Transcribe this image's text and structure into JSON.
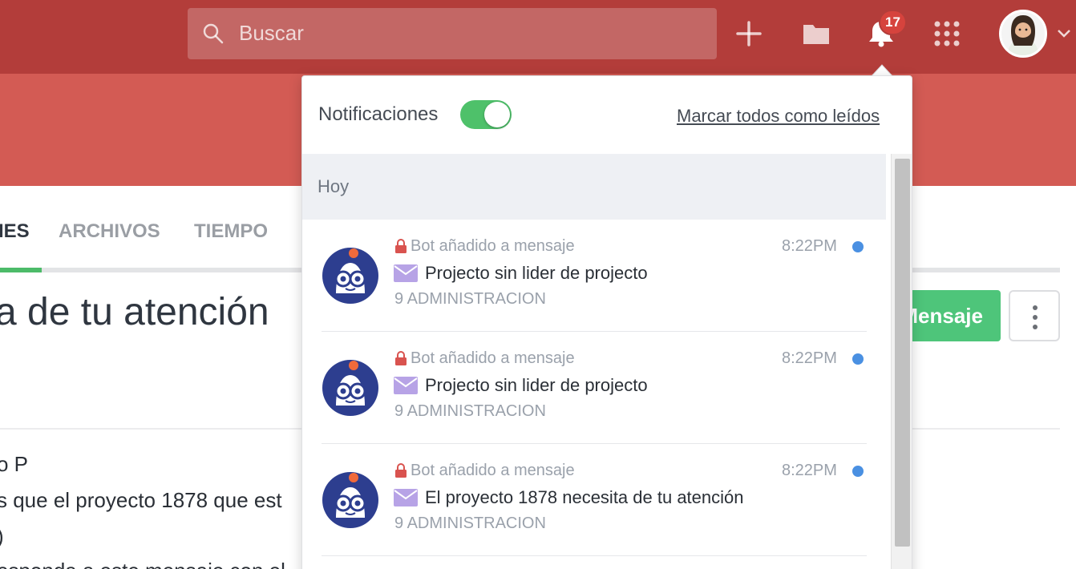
{
  "header": {
    "search_placeholder": "Buscar",
    "notification_count": "17",
    "icons": [
      "search-icon",
      "plus-icon",
      "folder-icon",
      "bell-icon",
      "apps-grid-icon",
      "chevron-down-icon"
    ],
    "bar_color": "#b33d3a",
    "banner_color": "#d35b54"
  },
  "tabs": [
    {
      "label": "IES",
      "active": true
    },
    {
      "label": "ARCHIVOS",
      "active": false
    },
    {
      "label": "TIEMPO",
      "active": false
    }
  ],
  "main": {
    "title": "a de tu atención",
    "message_button": "Mensaje",
    "body_lines": [
      "o P",
      "s que el proyecto 1878 que est",
      ")",
      "esponda a este mensaje con el"
    ]
  },
  "notifications_panel": {
    "title": "Notificaciones",
    "toggle_on": true,
    "mark_all_read": "Marcar todos como leídos",
    "day_header": "Hoy",
    "items": [
      {
        "sender": "Bot añadido a mensaje",
        "time": "8:22PM",
        "subject": "Projecto sin lider de projecto",
        "project": "9 ADMINISTRACION",
        "unread": true
      },
      {
        "sender": "Bot añadido a mensaje",
        "time": "8:22PM",
        "subject": "Projecto sin lider de projecto",
        "project": "9 ADMINISTRACION",
        "unread": true
      },
      {
        "sender": "Bot añadido a mensaje",
        "time": "8:22PM",
        "subject": "El proyecto 1878 necesita de tu atención",
        "project": "9 ADMINISTRACION",
        "unread": true
      }
    ]
  }
}
